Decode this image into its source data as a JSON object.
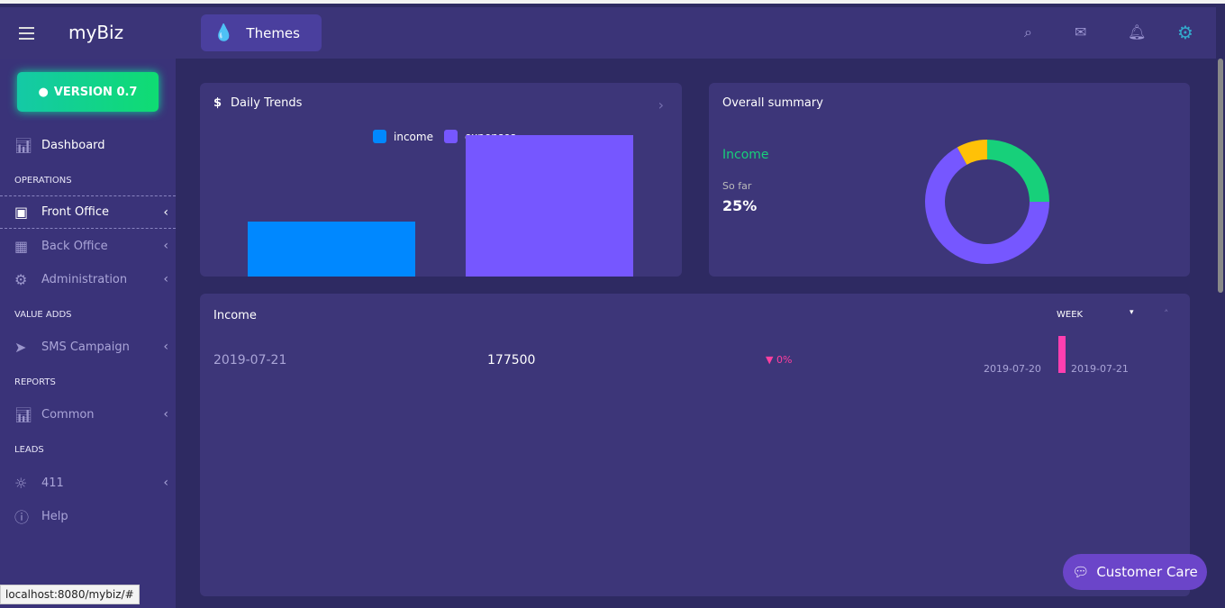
{
  "header": {
    "brand": "myBiz",
    "themes_label": "Themes",
    "icons": [
      "menu-icon",
      "search-icon",
      "mail-icon",
      "bell-icon",
      "settings-avatar-icon"
    ]
  },
  "sidebar": {
    "version_label": "VERSION 0.7",
    "dashboard": "Dashboard",
    "sections": {
      "operations": "OPERATIONS",
      "value_adds": "VALUE ADDS",
      "reports": "REPORTS",
      "leads": "LEADS"
    },
    "items": {
      "front_office": "Front Office",
      "back_office": "Back Office",
      "administration": "Administration",
      "sms": "SMS Campaign",
      "common": "Common",
      "p411": "411",
      "help": "Help"
    }
  },
  "daily_trends": {
    "title": "Daily Trends",
    "currency_symbol": "$",
    "chart_data": {
      "type": "bar",
      "categories": [
        "income",
        "expenses"
      ],
      "series": [
        {
          "name": "income",
          "value": 177500,
          "color": "#0088ff"
        },
        {
          "name": "expenses",
          "value": 460000,
          "color": "#7657ff"
        }
      ],
      "legend": "top-center",
      "grid": false
    }
  },
  "summary": {
    "title": "Overall summary",
    "label": "Income",
    "sub": "So far",
    "value": "25%",
    "chart_data": {
      "type": "pie",
      "donut": true,
      "slices": [
        {
          "value": 25,
          "color": "#17d07a"
        },
        {
          "value": 67,
          "color": "#7657ff"
        },
        {
          "value": 8,
          "color": "#ffc107"
        }
      ]
    }
  },
  "income": {
    "title": "Income",
    "period": "WEEK",
    "date": "2019-07-21",
    "amount": "177500",
    "change": "0%",
    "chart_data": {
      "type": "bar",
      "categories": [
        "2019-07-20",
        "2019-07-21"
      ],
      "values": [
        0,
        177500
      ],
      "color": "#ff3fb0"
    }
  },
  "status_url": "localhost:8080/mybiz/#",
  "customer_care": "Customer Care"
}
